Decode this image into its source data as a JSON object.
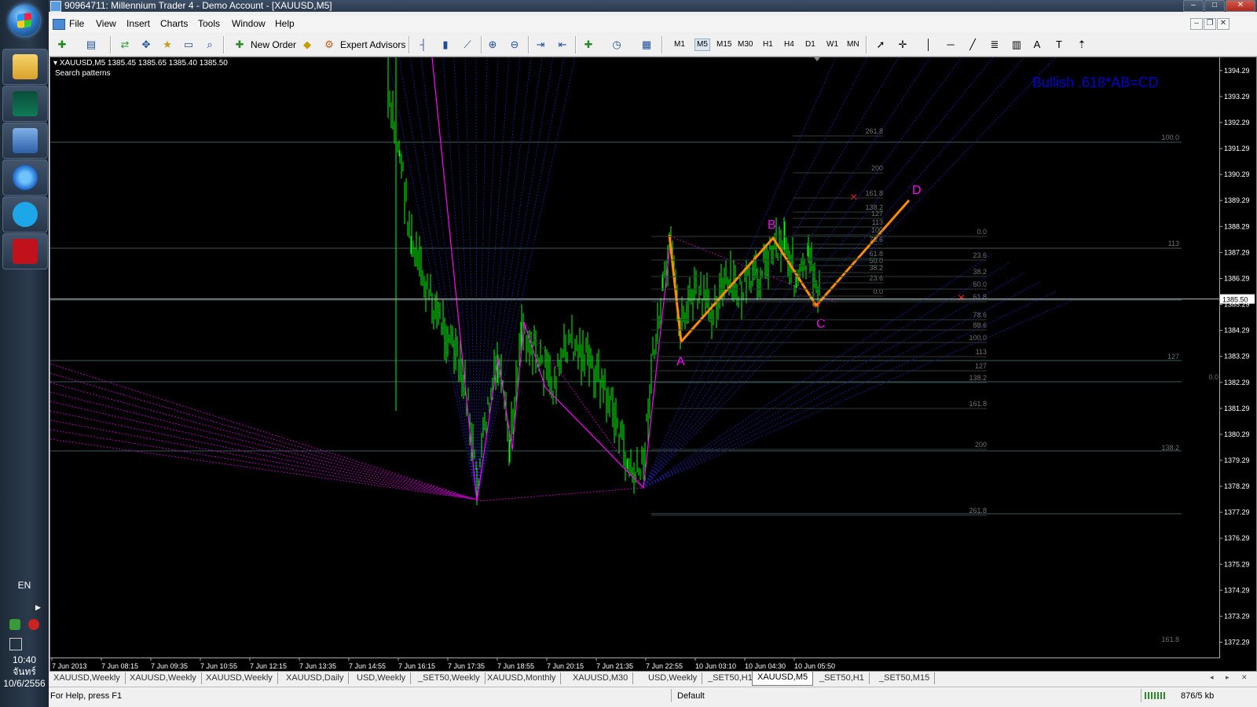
{
  "window": {
    "title": "90964711: Millennium Trader 4 - Demo Account - [XAUUSD,M5]"
  },
  "menu": [
    "File",
    "View",
    "Insert",
    "Charts",
    "Tools",
    "Window",
    "Help"
  ],
  "toolbar": {
    "new_order": "New Order",
    "expert_advisors": "Expert Advisors",
    "timeframes": [
      "M1",
      "M5",
      "M15",
      "M30",
      "H1",
      "H4",
      "D1",
      "W1",
      "MN"
    ],
    "active_timeframe": "M5"
  },
  "chart": {
    "symbol_info": "XAUUSD,M5  1385.45 1385.65 1385.40 1385.50",
    "indicator_label": "Search patterns",
    "pattern_title": "Bullish .618*AB=CD",
    "current_price": "1385.50",
    "price_ticks": [
      "1394.29",
      "1393.29",
      "1392.29",
      "1391.29",
      "1390.29",
      "1389.29",
      "1388.29",
      "1387.29",
      "1386.29",
      "1385.29",
      "1384.29",
      "1383.29",
      "1382.29",
      "1381.29",
      "1380.29",
      "1379.29",
      "1378.29",
      "1377.29",
      "1376.29",
      "1375.29",
      "1374.29",
      "1373.29",
      "1372.29"
    ],
    "time_ticks": [
      "7 Jun 2013",
      "7 Jun 08:15",
      "7 Jun 09:35",
      "7 Jun 10:55",
      "7 Jun 12:15",
      "7 Jun 13:35",
      "7 Jun 14:55",
      "7 Jun 16:15",
      "7 Jun 17:35",
      "7 Jun 18:55",
      "7 Jun 20:15",
      "7 Jun 21:35",
      "7 Jun 22:55",
      "10 Jun 03:10",
      "10 Jun 04:30",
      "10 Jun 05:50"
    ],
    "pattern_points": [
      "A",
      "B",
      "C",
      "D"
    ],
    "fib_labels_upper": [
      "261.8",
      "200",
      "161.8",
      "138.2",
      "127",
      "113",
      "100",
      "78.6",
      "61.8",
      "50.0",
      "38.2",
      "23.6",
      "0.0"
    ],
    "fib_labels_right": [
      "0.0",
      "23.6",
      "38.2",
      "50.0",
      "61.8",
      "78.6",
      "88.6",
      "100.0",
      "113",
      "127",
      "138.2",
      "161.8",
      "200",
      "261.8"
    ],
    "fib_labels_far": [
      "100.0",
      "113",
      "127",
      "0.0",
      "138.2",
      "161.8"
    ]
  },
  "tabs": [
    "XAUUSD,Weekly",
    "XAUUSD,Weekly",
    "XAUUSD,Weekly",
    "XAUUSD,Daily",
    "USD,Weekly",
    "_SET50,Weekly",
    "XAUUSD,Monthly",
    "XAUUSD,M30",
    "USD,Weekly",
    "_SET50,H1",
    "XAUUSD,M5",
    "_SET50,H1",
    "_SET50,M15"
  ],
  "active_tab": "XAUUSD,M5",
  "status": {
    "help": "For Help, press F1",
    "profile": "Default",
    "traffic": "876/5 kb"
  },
  "taskbar": {
    "language": "EN",
    "time": "10:40",
    "day": "จันทร์",
    "date": "10/6/2556"
  },
  "colors": {
    "candles": "#00ff00",
    "pattern": "#ff8c00",
    "zigzag": "#ff00ff",
    "fans": "#1a1a8c",
    "title": "#0000d6",
    "grid": "#3a5a5a"
  }
}
